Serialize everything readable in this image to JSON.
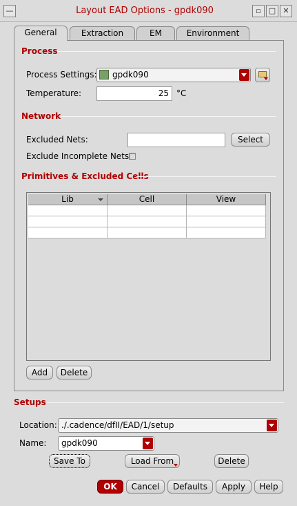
{
  "window": {
    "title": "Layout EAD Options - gpdk090",
    "menu_icon": "window-menu-icon",
    "controls": [
      "minimize-icon",
      "maximize-icon",
      "close-icon"
    ]
  },
  "tabs": [
    {
      "label": "General",
      "active": true
    },
    {
      "label": "Extraction",
      "active": false
    },
    {
      "label": "EM",
      "active": false
    },
    {
      "label": "Environment",
      "active": false
    }
  ],
  "process": {
    "section_title": "Process",
    "settings_label": "Process Settings:",
    "settings_value": "gpdk090",
    "temperature_label": "Temperature:",
    "temperature_value": "25",
    "temperature_unit": "°C"
  },
  "network": {
    "section_title": "Network",
    "excluded_nets_label": "Excluded Nets:",
    "excluded_nets_value": "",
    "select_button": "Select",
    "exclude_incomplete_label": "Exclude Incomplete Nets:",
    "exclude_incomplete_checked": false
  },
  "primitives": {
    "section_title": "Primitives & Excluded Cells",
    "columns": [
      "Lib",
      "Cell",
      "View"
    ],
    "rows": [
      [
        "",
        "",
        ""
      ],
      [
        "",
        "",
        ""
      ],
      [
        "",
        "",
        ""
      ]
    ],
    "add_button": "Add",
    "delete_button": "Delete"
  },
  "setups": {
    "section_title": "Setups",
    "location_label": "Location:",
    "location_value": "./.cadence/dfII/EAD/1/setup",
    "name_label": "Name:",
    "name_value": "gpdk090",
    "save_to_button": "Save To",
    "load_from_button": "Load From",
    "delete_button": "Delete"
  },
  "footer": {
    "ok": "OK",
    "cancel": "Cancel",
    "defaults": "Defaults",
    "apply": "Apply",
    "help": "Help"
  },
  "colors": {
    "accent": "#b00000",
    "background": "#dcdcdc"
  }
}
